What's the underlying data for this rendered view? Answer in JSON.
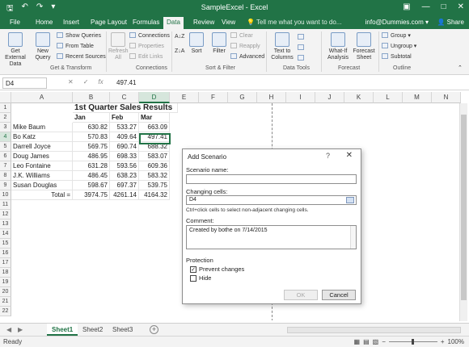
{
  "window": {
    "title": "SampleExcel - Excel",
    "tell_me": "Tell me what you want to do...",
    "account": "info@Dummies.com ▾",
    "share": "Share"
  },
  "tabs": [
    "File",
    "Home",
    "Insert",
    "Page Layout",
    "Formulas",
    "Data",
    "Review",
    "View",
    "Help"
  ],
  "active_tab": "Data",
  "ribbon": {
    "get_external_data": "Get External Data",
    "new_query": "New Query",
    "show_queries": "Show Queries",
    "from_table": "From Table",
    "recent_sources": "Recent Sources",
    "refresh_all": "Refresh All",
    "connections": "Connections",
    "properties": "Properties",
    "edit_links": "Edit Links",
    "sort_az": "A↓Z",
    "sort_za": "Z↓A",
    "sort": "Sort",
    "filter": "Filter",
    "clear": "Clear",
    "reapply": "Reapply",
    "advanced": "Advanced",
    "text_to_columns": "Text to Columns",
    "what_if": "What-If Analysis",
    "forecast_sheet": "Forecast Sheet",
    "group": "Group",
    "ungroup": "Ungroup",
    "subtotal": "Subtotal",
    "groups": [
      "Get & Transform",
      "Connections",
      "Sort & Filter",
      "Data Tools",
      "Forecast",
      "Outline"
    ]
  },
  "formula_bar": {
    "name_box": "D4",
    "value": "497.41"
  },
  "grid": {
    "columns": [
      "A",
      "B",
      "C",
      "D",
      "E",
      "F",
      "G",
      "H",
      "I",
      "J",
      "K",
      "L",
      "M",
      "N"
    ],
    "rows": [
      "1",
      "2",
      "3",
      "4",
      "5",
      "6",
      "7",
      "8",
      "9",
      "10",
      "11",
      "12",
      "13",
      "14",
      "15",
      "16",
      "17",
      "18",
      "19",
      "20",
      "21",
      "22"
    ],
    "title": "1st Quarter Sales Results",
    "headers": [
      "Jan",
      "Feb",
      "Mar"
    ],
    "data": [
      {
        "name": "Mike Baum",
        "jan": "630.82",
        "feb": "533.27",
        "mar": "663.09"
      },
      {
        "name": "Bo Katz",
        "jan": "570.83",
        "feb": "409.64",
        "mar": "497.41"
      },
      {
        "name": "Darrell Joyce",
        "jan": "569.75",
        "feb": "690.74",
        "mar": "688.32"
      },
      {
        "name": "Doug James",
        "jan": "486.95",
        "feb": "698.33",
        "mar": "583.07"
      },
      {
        "name": "Leo Fontaine",
        "jan": "631.28",
        "feb": "593.56",
        "mar": "609.36"
      },
      {
        "name": "J.K. Williams",
        "jan": "486.45",
        "feb": "638.23",
        "mar": "583.32"
      },
      {
        "name": "Susan Douglas",
        "jan": "598.67",
        "feb": "697.37",
        "mar": "539.75"
      }
    ],
    "total": {
      "label": "Total =",
      "jan": "3974.75",
      "feb": "4261.14",
      "mar": "4164.32"
    }
  },
  "dialog": {
    "title": "Add Scenario",
    "help": "?",
    "close": "✕",
    "scenario_name_label": "Scenario name:",
    "scenario_name_value": "",
    "changing_cells_label": "Changing cells:",
    "changing_cells_value": "D4",
    "hint": "Ctrl+click cells to select non-adjacent changing cells.",
    "comment_label": "Comment:",
    "comment_value": "Created by bothe on 7/14/2015",
    "protection_label": "Protection",
    "prevent_changes": "Prevent changes",
    "prevent_changes_checked": true,
    "hide": "Hide",
    "hide_checked": false,
    "ok": "OK",
    "cancel": "Cancel"
  },
  "sheets": [
    "Sheet1",
    "Sheet2",
    "Sheet3"
  ],
  "active_sheet": "Sheet1",
  "status": {
    "ready": "Ready",
    "zoom_minus": "−",
    "zoom_plus": "+",
    "zoom": "100%"
  }
}
